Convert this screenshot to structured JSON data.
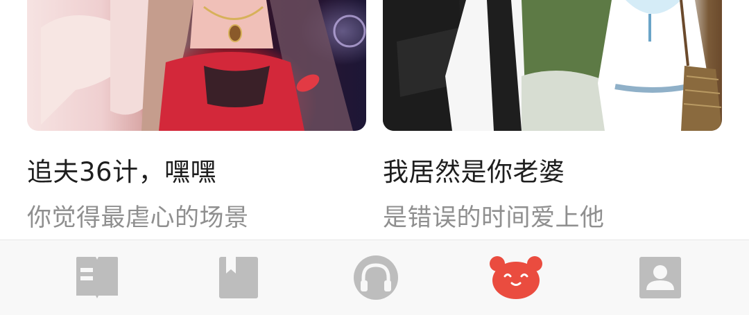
{
  "feed": {
    "cards": [
      {
        "title": "追夫36计，嘿嘿",
        "subtitle": "你觉得最虐心的场景"
      },
      {
        "title": "我居然是你老婆",
        "subtitle": "是错误的时间爱上他"
      }
    ]
  },
  "tabbar": {
    "accent_color": "#ea4c3f",
    "inactive_color": "#bdbdbd",
    "tabs": [
      {
        "icon": "book-open-icon",
        "active": false
      },
      {
        "icon": "bookmark-book-icon",
        "active": false
      },
      {
        "icon": "headphones-icon",
        "active": false
      },
      {
        "icon": "bear-face-icon",
        "active": true
      },
      {
        "icon": "user-profile-icon",
        "active": false
      }
    ]
  }
}
